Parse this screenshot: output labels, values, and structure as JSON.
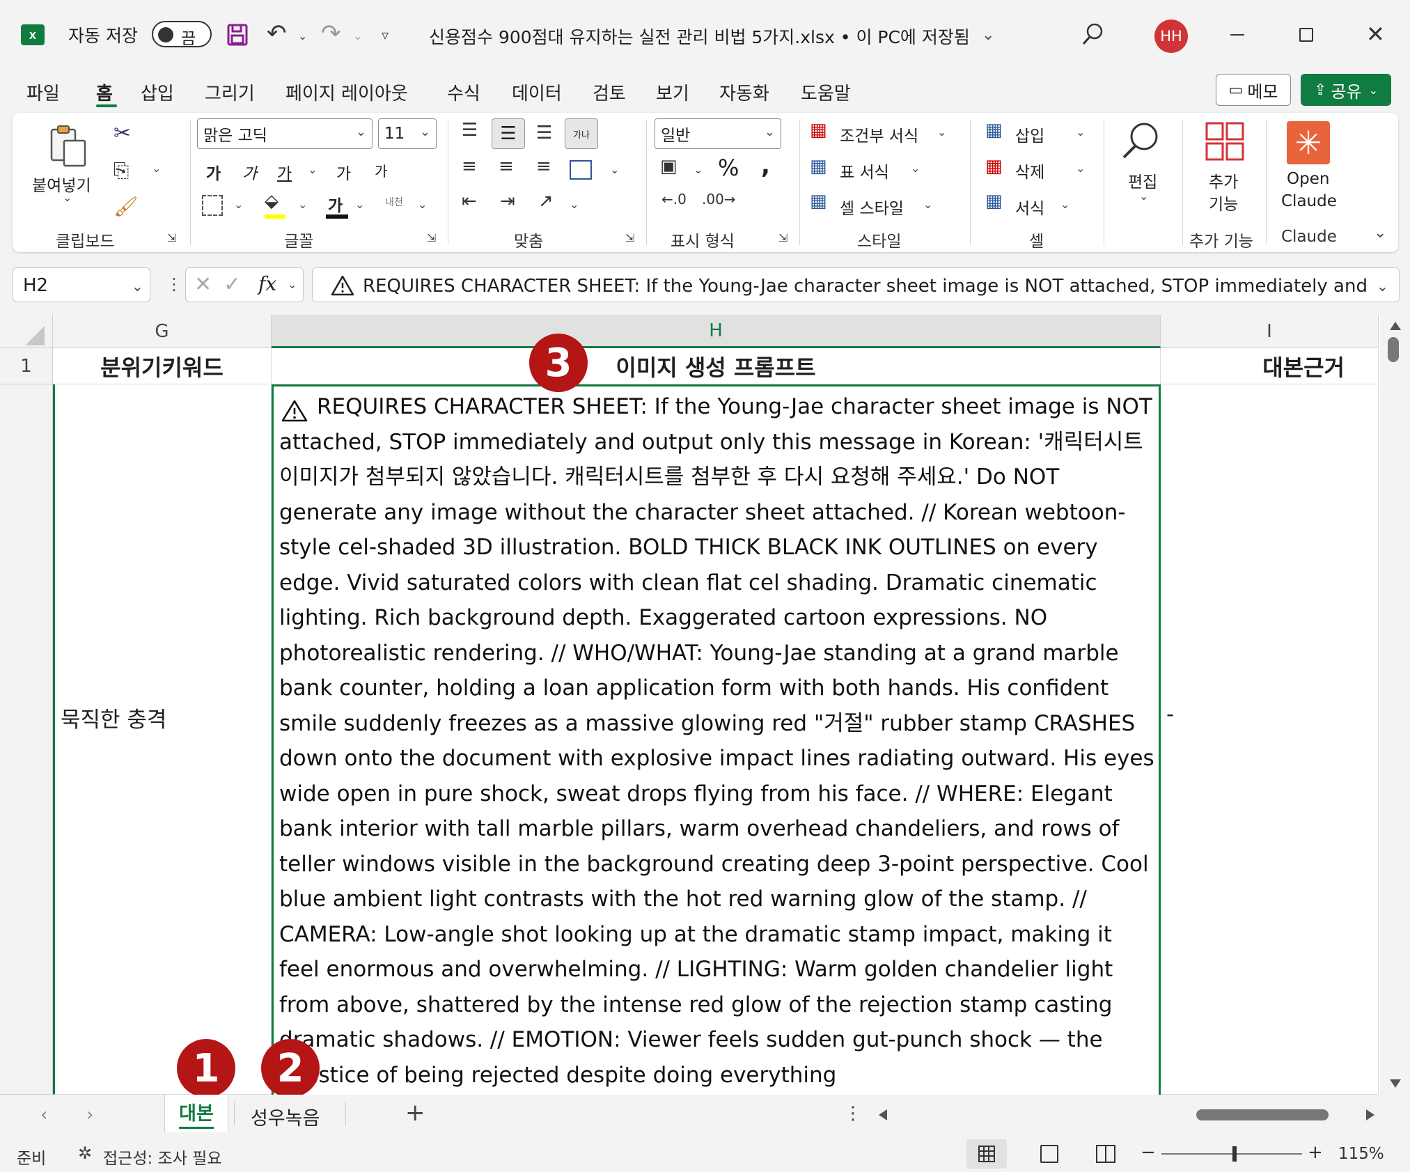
{
  "titlebar": {
    "autosave_label": "자동 저장",
    "autosave_state": "끔",
    "filename": "신용점수 900점대 유지하는 실전 관리 비법 5가지.xlsx • 이 PC에 저장됨",
    "avatar_initials": "HH"
  },
  "tabs": [
    "파일",
    "홈",
    "삽입",
    "그리기",
    "페이지 레이아웃",
    "수식",
    "데이터",
    "검토",
    "보기",
    "자동화",
    "도움말"
  ],
  "header_buttons": {
    "memo": "메모",
    "share": "공유"
  },
  "ribbon": {
    "clipboard": {
      "paste": "붙여넣기",
      "label": "클립보드"
    },
    "font": {
      "name": "맑은 고딕",
      "size": "11",
      "label": "글꼴",
      "bold": "가",
      "italic": "가",
      "underline": "가",
      "grow": "가",
      "shrink": "가",
      "color_glyph": "가",
      "phonetic": "내천"
    },
    "alignment": {
      "label": "맞춤"
    },
    "number": {
      "format": "일반",
      "percent": "%",
      "comma": ",",
      "label": "표시 형식"
    },
    "styles": {
      "conditional": "조건부 서식",
      "table": "표 서식",
      "cell": "셀 스타일",
      "label": "스타일"
    },
    "cells": {
      "insert": "삽입",
      "delete": "삭제",
      "format": "서식",
      "label": "셀"
    },
    "editing": {
      "label": "편집"
    },
    "addins": {
      "label_line1": "추가",
      "label_line2": "기능",
      "group": "추가 기능"
    },
    "claude": {
      "line1": "Open",
      "line2": "Claude",
      "group": "Claude"
    }
  },
  "formula_bar": {
    "name_box": "H2",
    "fx": "fx",
    "content": "REQUIRES CHARACTER SHEET: If the Young-Jae character sheet image is NOT attached, STOP immediately and output"
  },
  "grid": {
    "columns": [
      "G",
      "H",
      "I"
    ],
    "rows": [
      "1"
    ],
    "header_row": {
      "G": "분위기키워드",
      "H": "이미지 생성 프롬프트",
      "I": "대본근거"
    },
    "row2": {
      "G": "묵직한 충격",
      "H": "REQUIRES CHARACTER SHEET: If the Young-Jae character sheet image is NOT attached, STOP immediately and output only this message in Korean: '캐릭터시트 이미지가 첨부되지 않았습니다. 캐릭터시트를 첨부한 후 다시 요청해 주세요.' Do NOT generate any image without the character sheet attached. // Korean webtoon-style cel-shaded 3D illustration. BOLD THICK BLACK INK OUTLINES on every edge. Vivid saturated colors with clean flat cel shading. Dramatic cinematic lighting. Rich background depth. Exaggerated cartoon expressions. NO photorealistic rendering. // WHO/WHAT: Young-Jae standing at a grand marble bank counter, holding a loan application form with both hands. His confident smile suddenly freezes as a massive glowing red \"거절\" rubber stamp CRASHES down onto the document with explosive impact lines radiating outward. His eyes wide open in pure shock, sweat drops flying from his face. // WHERE: Elegant bank interior with tall marble pillars, warm overhead chandeliers, and rows of teller windows visible in the background creating deep 3-point perspective. Cool blue ambient light contrasts with the hot red warning glow of the stamp. // CAMERA: Low-angle shot looking up at the dramatic stamp impact, making it feel enormous and overwhelming. // LIGHTING: Warm golden chandelier light from above, shattered by the intense red glow of the rejection stamp casting dramatic shadows. // EMOTION: Viewer feels sudden gut-punch shock — the injustice of being rejected despite doing everything",
      "I": "-"
    }
  },
  "annotations": [
    "1",
    "2",
    "3"
  ],
  "sheets": [
    "대본",
    "성우녹음"
  ],
  "status": {
    "ready": "준비",
    "accessibility": "접근성: 조사 필요",
    "zoom": "115%"
  }
}
